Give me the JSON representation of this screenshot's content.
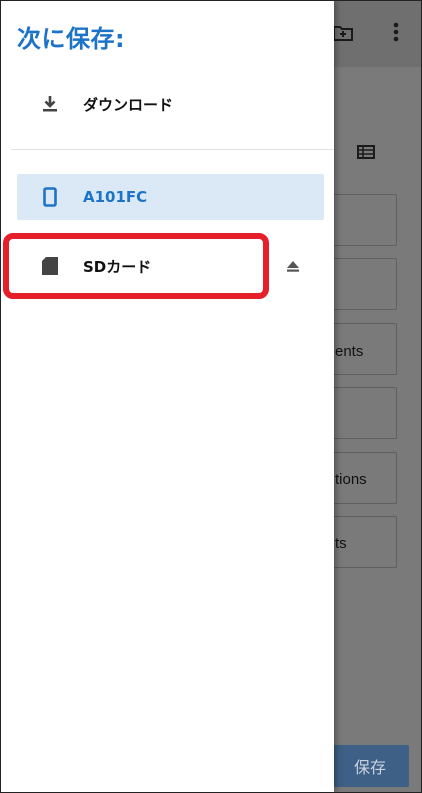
{
  "drawer": {
    "title": "次に保存:",
    "items": [
      {
        "label": "ダウンロード",
        "icon": "download-icon"
      },
      {
        "label": "A101FC",
        "icon": "phone-icon",
        "selected": true
      },
      {
        "label": "SDカード",
        "icon": "sd-card-icon",
        "highlighted": true
      }
    ],
    "eject_icon": "eject-icon"
  },
  "background": {
    "card_texts": [
      "ents",
      "tions",
      "ts"
    ],
    "save_label": "保存"
  },
  "colors": {
    "accent": "#1d73c8",
    "selected_bg": "#dbe9f6",
    "highlight": "#e6202a",
    "save_button": "#3e5f86"
  }
}
